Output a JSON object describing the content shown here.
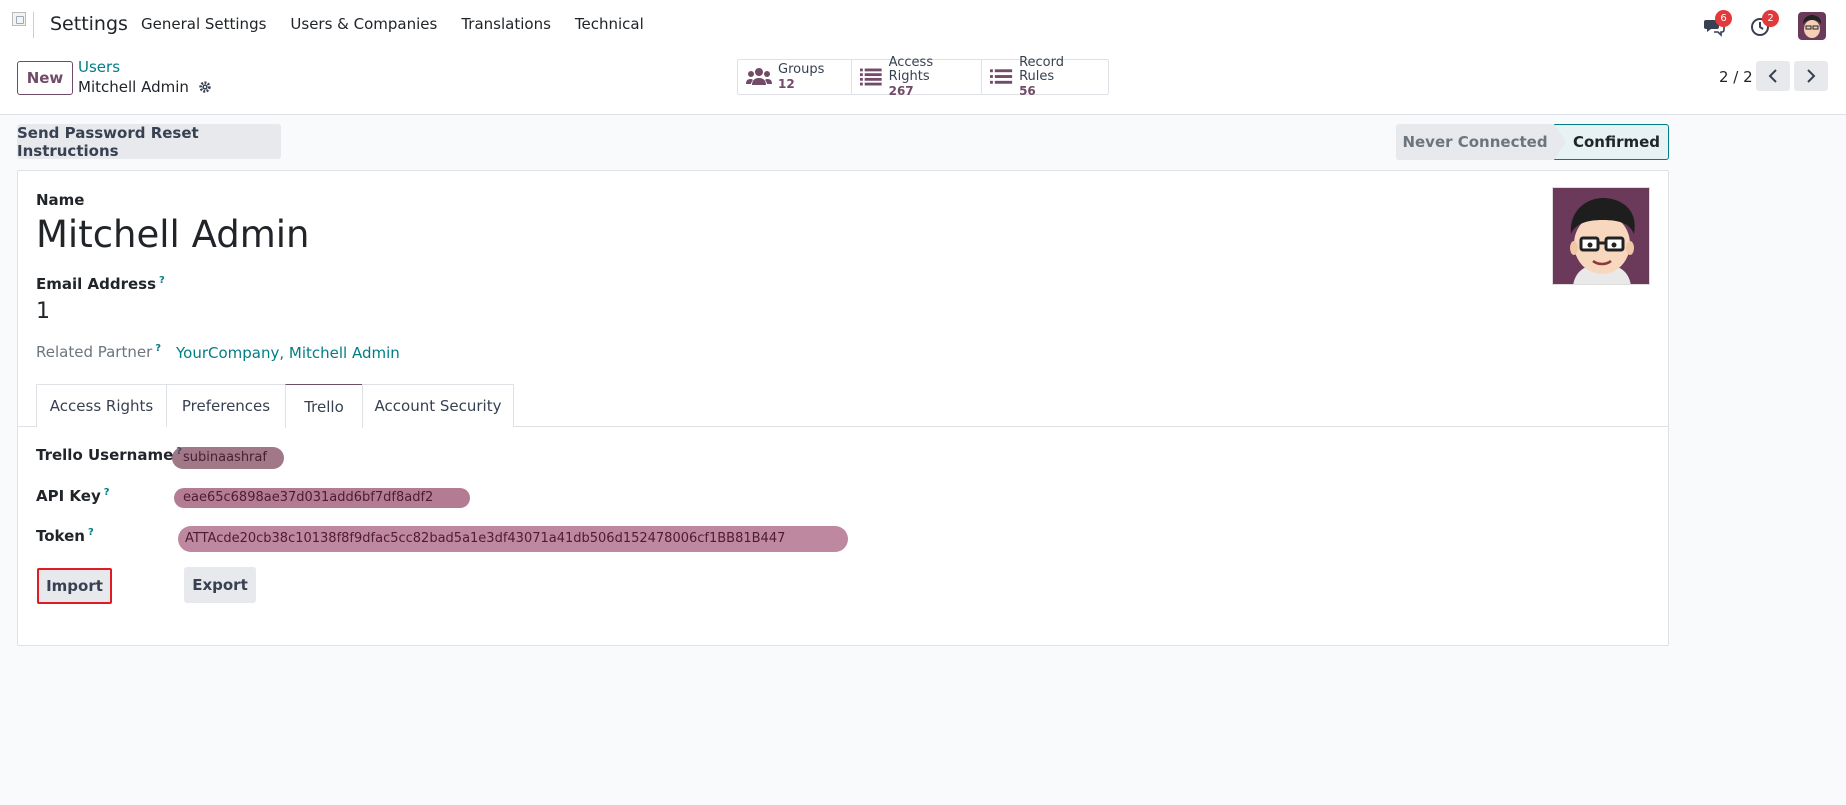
{
  "navbar": {
    "app_name": "Settings",
    "menu": [
      "General Settings",
      "Users & Companies",
      "Translations",
      "Technical"
    ],
    "messages_badge": "6",
    "activities_badge": "2"
  },
  "control": {
    "new_label": "New",
    "breadcrumb_parent": "Users",
    "breadcrumb_current": "Mitchell Admin",
    "smart_buttons": [
      {
        "label": "Groups",
        "value": "12",
        "icon": "users-icon"
      },
      {
        "label": "Access Rights",
        "value": "267",
        "icon": "list-icon"
      },
      {
        "label": "Record Rules",
        "value": "56",
        "icon": "list-icon"
      }
    ],
    "pager": "2 / 2"
  },
  "statusbar": {
    "reset_button": "Send Password Reset Instructions",
    "stage_inactive": "Never Connected",
    "stage_active": "Confirmed"
  },
  "form": {
    "name_label": "Name",
    "name_value": "Mitchell Admin",
    "email_label": "Email Address",
    "email_help": "?",
    "email_value": "1",
    "partner_label": "Related Partner",
    "partner_help": "?",
    "partner_value": "YourCompany, Mitchell Admin",
    "tabs": [
      "Access Rights",
      "Preferences",
      "Trello",
      "Account Security"
    ],
    "active_tab": "Trello",
    "trello": {
      "username_label": "Trello Username",
      "username_value": "subinaashraf",
      "api_key_label": "API Key",
      "api_key_value": "eae65c6898ae37d031add6bf7df8adf2",
      "token_label": "Token",
      "token_value": "ATTAcde20cb38c10138f8f9dfac5cc82bad5a1e3df43071a41db506d152478006cf1BB81B447",
      "help": "?"
    },
    "import_label": "Import",
    "export_label": "Export"
  },
  "colors": {
    "brand": "#714b67",
    "link": "#017e84",
    "highlight": "#e01b24"
  }
}
